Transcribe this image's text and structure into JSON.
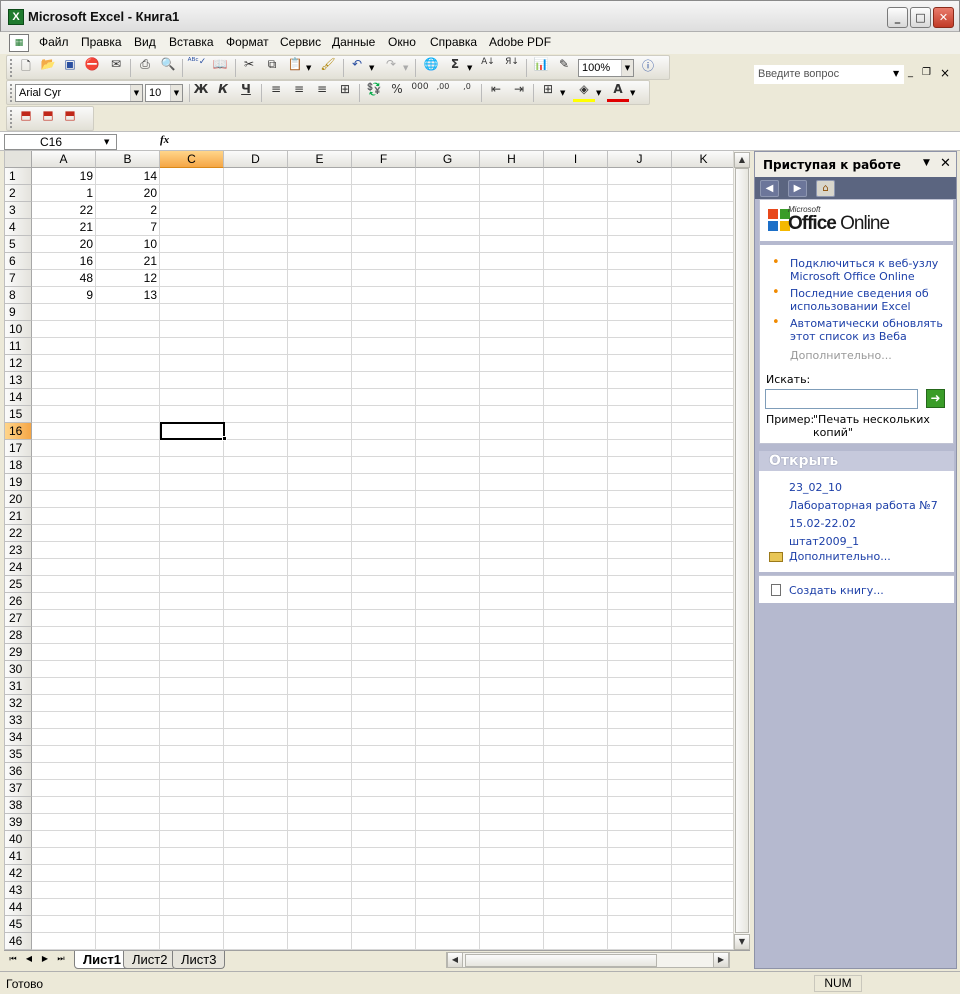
{
  "window": {
    "title": "Microsoft Excel - Книга1",
    "app_icon": "excel-icon"
  },
  "menu": {
    "items": [
      "Файл",
      "Правка",
      "Вид",
      "Вставка",
      "Формат",
      "Сервис",
      "Данные",
      "Окно",
      "Справка",
      "Adobe PDF"
    ],
    "help_placeholder": "Введите вопрос"
  },
  "toolbar": {
    "zoom": "100%",
    "font_name": "Arial Cyr",
    "font_size": "10",
    "bold": "Ж",
    "italic": "К",
    "underline": "Ч",
    "percent": "%",
    "thousands": "000",
    "sigma": "Σ",
    "inc_decimal": ",00",
    "dec_decimal": ",0"
  },
  "formula_bar": {
    "name_box": "C16",
    "fx": "fx",
    "content": ""
  },
  "grid": {
    "columns": [
      "A",
      "B",
      "C",
      "D",
      "E",
      "F",
      "G",
      "H",
      "I",
      "J",
      "K"
    ],
    "active_column": "C",
    "active_row": "16",
    "rows": [
      "1",
      "2",
      "3",
      "4",
      "5",
      "6",
      "7",
      "8",
      "9",
      "10",
      "11",
      "12",
      "13",
      "14",
      "15",
      "16",
      "17",
      "18",
      "19",
      "20",
      "21",
      "22",
      "23",
      "24",
      "25",
      "26",
      "27",
      "28",
      "29",
      "30",
      "31",
      "32",
      "33",
      "34",
      "35",
      "36",
      "37",
      "38",
      "39",
      "40",
      "41",
      "42",
      "43",
      "44",
      "45",
      "46"
    ],
    "data": [
      {
        "A": "19",
        "B": "14"
      },
      {
        "A": "1",
        "B": "20"
      },
      {
        "A": "22",
        "B": "2"
      },
      {
        "A": "21",
        "B": "7"
      },
      {
        "A": "20",
        "B": "10"
      },
      {
        "A": "16",
        "B": "21"
      },
      {
        "A": "48",
        "B": "12"
      },
      {
        "A": "9",
        "B": "13"
      }
    ]
  },
  "sheets": {
    "tabs": [
      "Лист1",
      "Лист2",
      "Лист3"
    ],
    "active": "Лист1"
  },
  "status": {
    "ready": "Готово",
    "num": "NUM"
  },
  "taskpane": {
    "title": "Приступая к работе",
    "logo_small": "Microsoft",
    "logo_office": "Office",
    "logo_online": " Online",
    "links": [
      "Подключиться к веб-узлу Microsoft Office Online",
      "Последние сведения об использовании Excel",
      "Автоматически обновлять этот список из Веба"
    ],
    "more": "Дополнительно...",
    "search_label": "Искать:",
    "example_label": "Пример:",
    "example_text": "\"Печать нескольких копий\"",
    "open_title": "Открыть",
    "recent_files": [
      "23_02_10",
      "Лабораторная работа №7",
      "15.02-22.02",
      "штат2009_1"
    ],
    "open_more": "Дополнительно...",
    "create": "Создать книгу..."
  }
}
